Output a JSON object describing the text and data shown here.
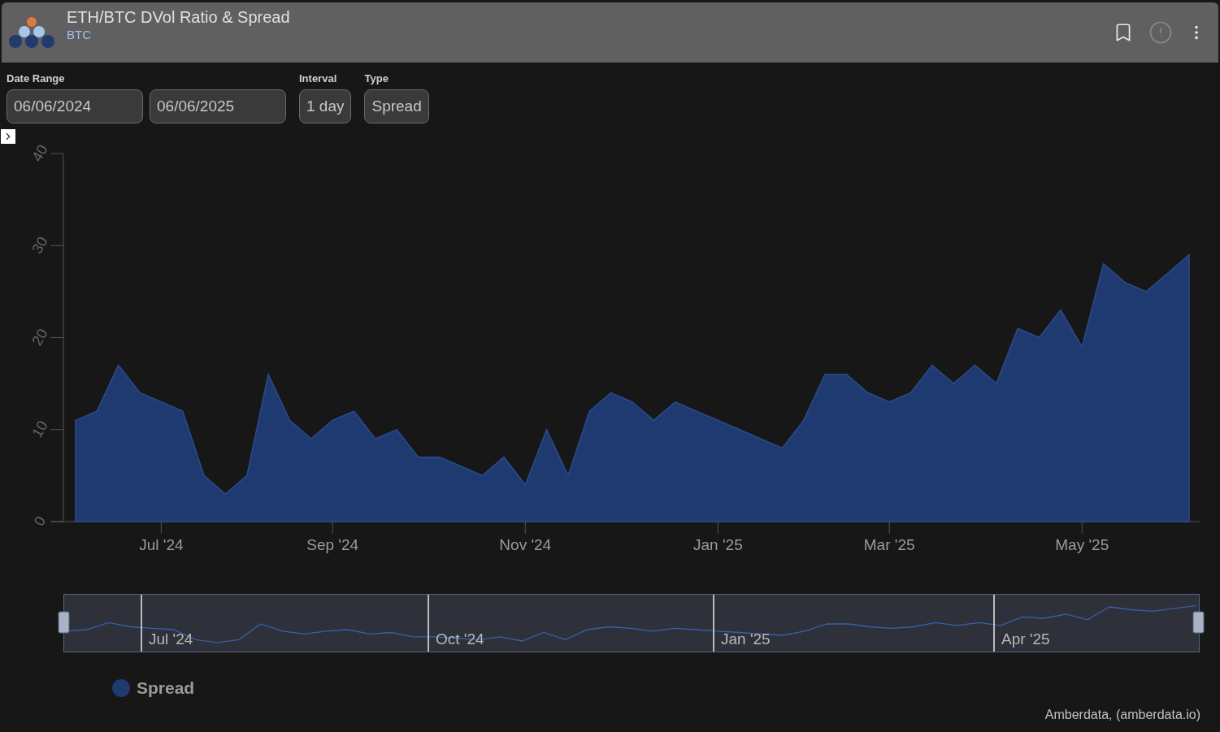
{
  "header": {
    "title": "ETH/BTC DVol Ratio & Spread",
    "subtitle": "BTC"
  },
  "controls": [
    {
      "label": "Date Range",
      "fields": [
        "06/06/2024",
        "06/06/2025"
      ]
    },
    {
      "label": "Interval",
      "fields": [
        "1 day"
      ]
    },
    {
      "label": "Type",
      "fields": [
        "Spread"
      ]
    }
  ],
  "chart": {
    "chart_data": {
      "type": "area",
      "categories": [
        null,
        null,
        null,
        null,
        "Jul '24",
        null,
        null,
        null,
        null,
        null,
        null,
        null,
        "Sep '24",
        null,
        null,
        null,
        null,
        null,
        null,
        null,
        null,
        "Nov '24",
        null,
        null,
        null,
        null,
        null,
        null,
        null,
        null,
        "Jan '25",
        null,
        null,
        null,
        null,
        null,
        null,
        null,
        "Mar '25",
        null,
        null,
        null,
        null,
        null,
        null,
        null,
        null,
        "May '25",
        null,
        null,
        null,
        null,
        null
      ],
      "series": [
        {
          "name": "Spread",
          "color": "#1f3a70",
          "values": [
            11,
            12,
            17,
            14,
            13,
            12,
            5,
            3,
            5,
            16,
            11,
            9,
            11,
            12,
            9,
            10,
            7,
            7,
            6,
            5,
            7,
            4,
            10,
            5,
            12,
            14,
            13,
            11,
            13,
            12,
            11,
            10,
            9,
            8,
            11,
            16,
            16,
            14,
            13,
            14,
            17,
            15,
            17,
            15,
            21,
            20,
            23,
            19,
            28,
            26,
            25,
            27,
            29
          ]
        }
      ],
      "ylim": [
        0,
        40
      ],
      "yticks": [
        0,
        10,
        20,
        30,
        40
      ]
    },
    "navigator": {
      "labels": [
        "Jul '24",
        "Oct '24",
        "Jan '25",
        "Apr '25"
      ]
    }
  },
  "credit": "Amberdata, (amberdata.io)"
}
